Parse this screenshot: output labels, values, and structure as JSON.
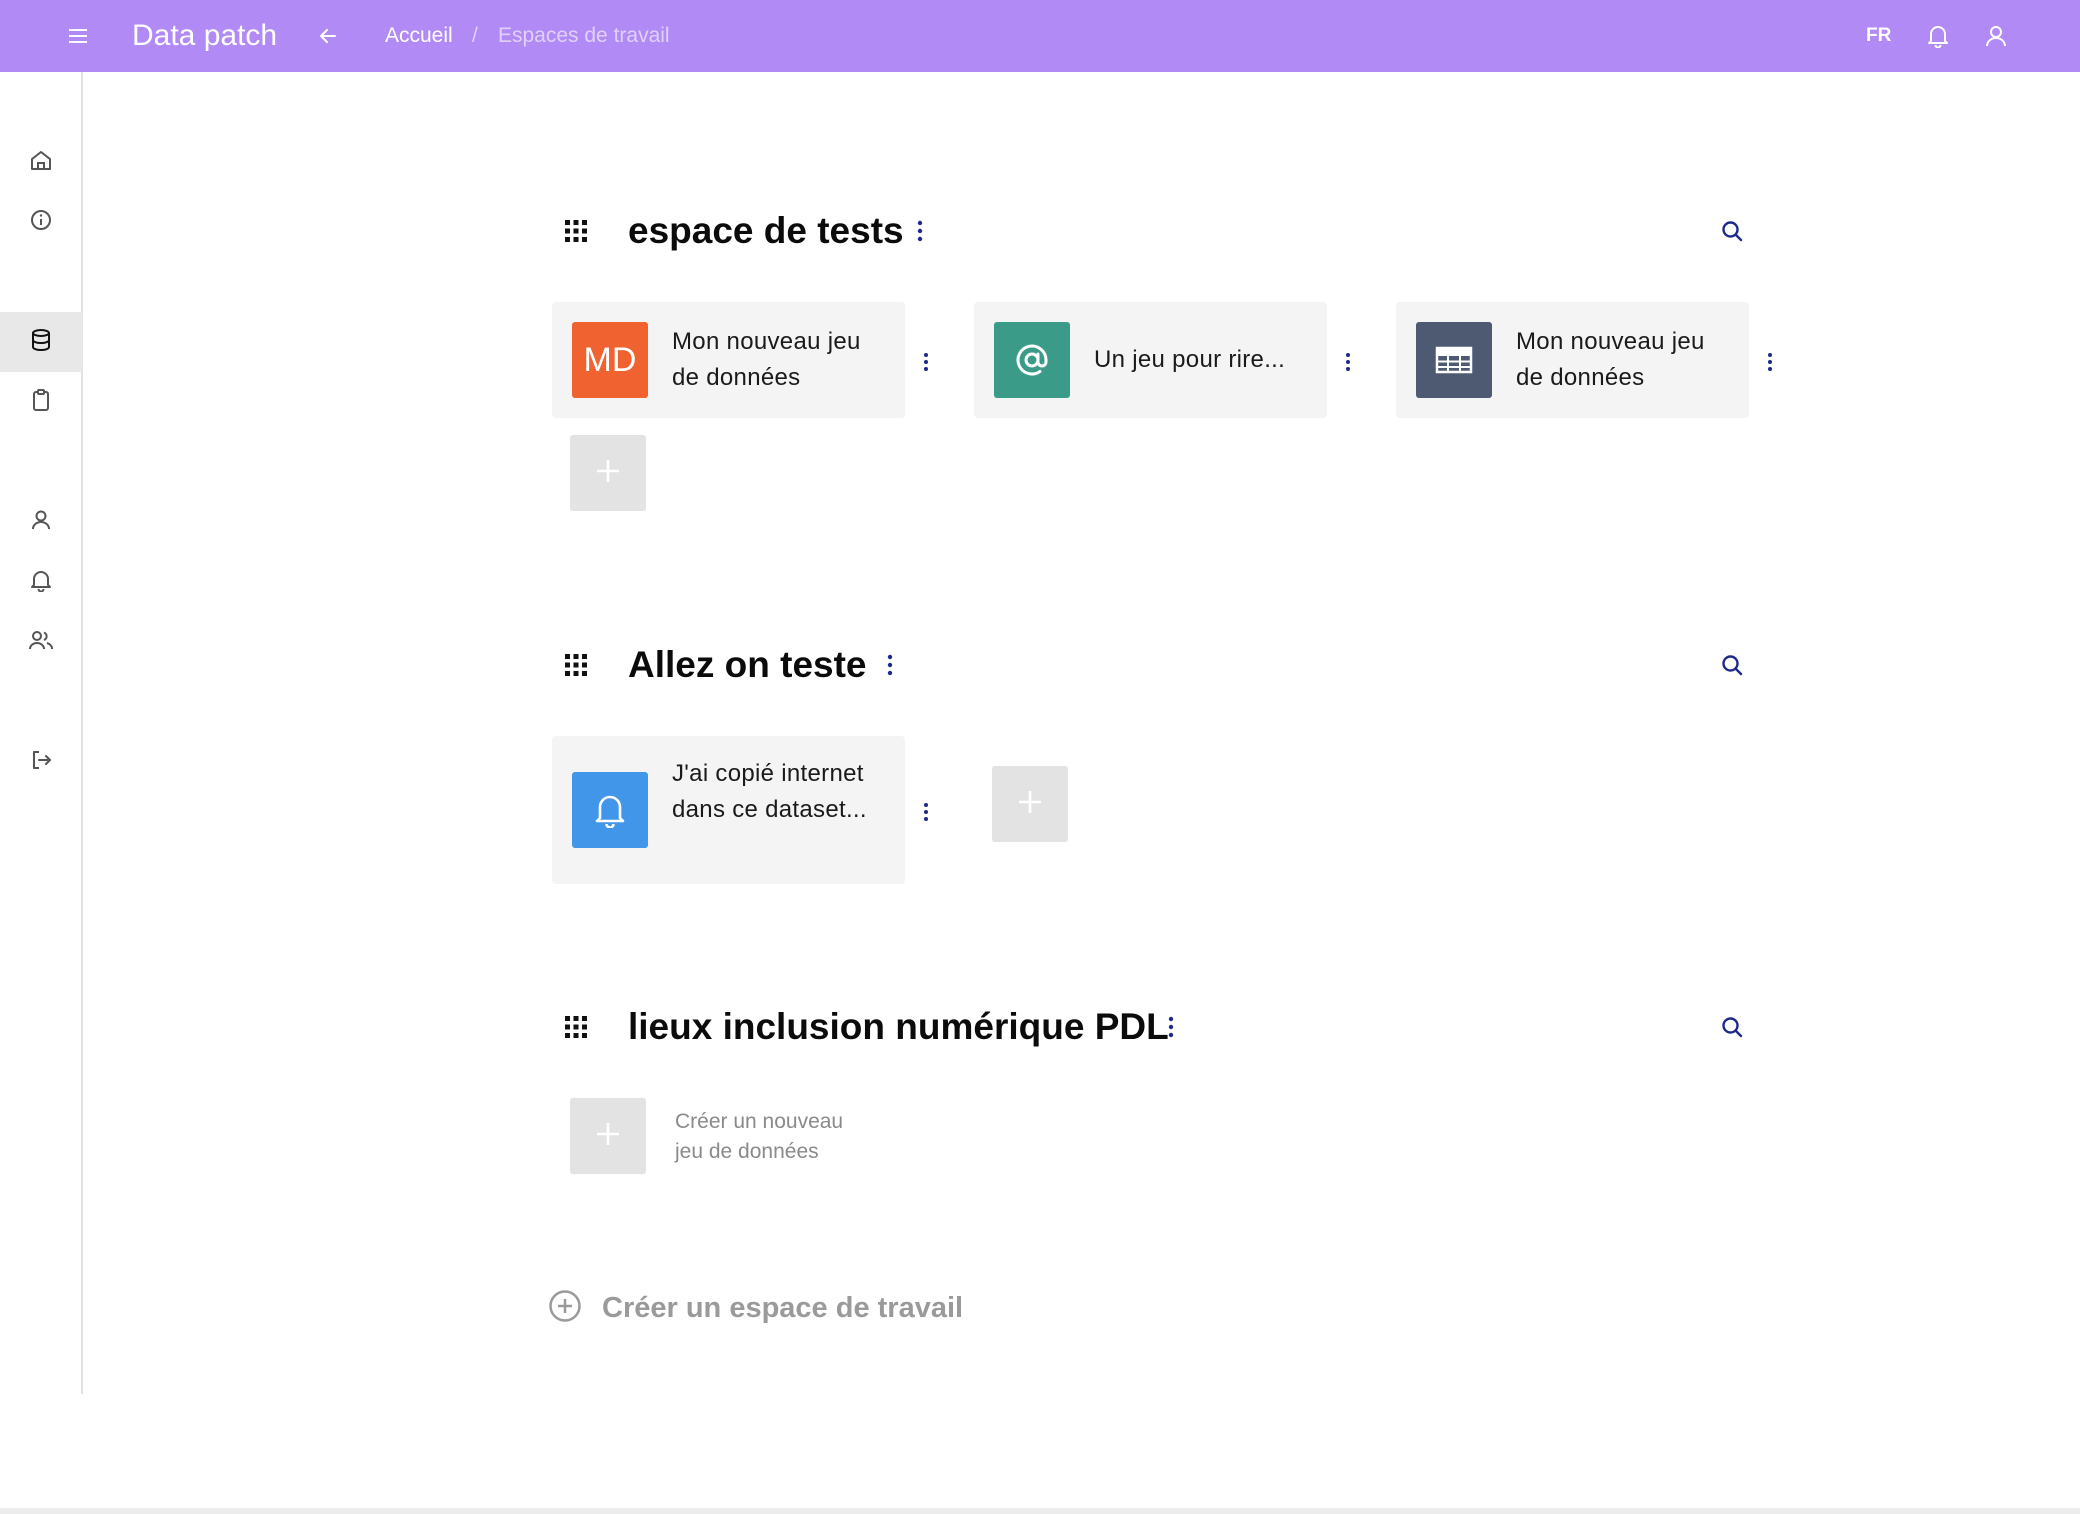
{
  "app": {
    "title": "Data patch",
    "accent_color": "#b18af5"
  },
  "breadcrumb": {
    "home": "Accueil",
    "separator": "/",
    "current": "Espaces de travail"
  },
  "header_right": {
    "language": "FR",
    "icons": [
      "bell-icon",
      "user-icon"
    ]
  },
  "sidebar": {
    "items": [
      {
        "icon": "home-icon"
      },
      {
        "icon": "info-icon"
      },
      {
        "icon": "database-icon",
        "active": true
      },
      {
        "icon": "clipboard-icon"
      },
      {
        "icon": "user-icon"
      },
      {
        "icon": "bell-icon"
      },
      {
        "icon": "users-icon"
      },
      {
        "icon": "logout-icon"
      }
    ]
  },
  "workspaces": [
    {
      "title": "espace de tests",
      "datasets": [
        {
          "label": "Mon nouveau jeu de données",
          "icon_text": "MD",
          "icon": "initials",
          "color": "#f0622f"
        },
        {
          "label": "Un jeu pour rire...",
          "icon_text": "@",
          "icon": "at-icon",
          "color": "#3a9b88"
        },
        {
          "label": "Mon nouveau jeu de données",
          "icon": "table-icon",
          "color": "#4e5a72"
        }
      ]
    },
    {
      "title": "Allez on teste",
      "datasets": [
        {
          "label": "J'ai copié internet dans ce dataset...",
          "icon": "bell-icon",
          "color": "#4196ea"
        }
      ]
    },
    {
      "title": "lieux inclusion numérique PDL",
      "datasets": [],
      "empty_label": "Créer un nouveau jeu de données"
    }
  ],
  "create_workspace_label": "Créer un espace de travail"
}
